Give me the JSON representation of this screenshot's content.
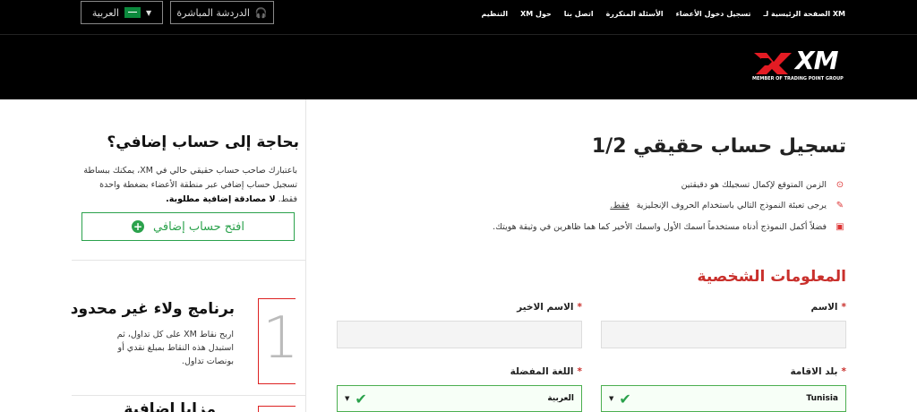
{
  "topbar": {
    "nav": [
      "الصفحة الرئيسية لـ XM",
      "تسجيل دخول الأعضاء",
      "الأسئلة المتكررة",
      "اتصل بنا",
      "XM حول",
      "التنظيم"
    ],
    "live_chat": "الدردشة المباشرة",
    "language": "العربية"
  },
  "logo": {
    "text": "XM",
    "subtitle": "MEMBER OF TRADING POINT GROUP"
  },
  "sidebar": {
    "extra_title": "بحاجة إلى حساب إضافي؟",
    "extra_text": "باعتبارك صاحب حساب حقيقي حالي في XM، يمكنك ببساطة تسجيل حساب إضافي عبر منطقة الأعضاء بضغطة واحدة فقط.",
    "extra_text_bold": "لا مصادقة إضافية مطلوبة.",
    "open_button": "افتح حساب إضافي",
    "loyalty_title": "برنامج ولاء غير محدود",
    "loyalty_text": "اربح نقاط XM على كل تداول، ثم استبدل هذه النقاط بمبلغ نقدي أو بونصات تداول.",
    "loyalty_number": "1",
    "third_title": "مزايا إضافية"
  },
  "main": {
    "title": "تسجيل حساب حقيقي 1/2",
    "note1": "الزمن المتوقع لإكمال تسجيلك هو دقيقتين",
    "note2_pre": "يرجى تعبئة النموذج التالي باستخدام الحروف الإنجليزية",
    "note2_u": "فقط.",
    "note3": "فضلاً أكمل النموذج أدناه مستخدماً اسمك الأول واسمك الأخير كما هما ظاهرين في وثيقة هويتك.",
    "section_title": "المعلومات الشخصية",
    "first_name_label": "الاسم",
    "last_name_label": "الاسم الاخير",
    "country_label": "بلد الاقامة",
    "language_label": "اللغة المفضلة",
    "country_value": "Tunisia",
    "language_value": "العربية",
    "required_mark": "*"
  }
}
